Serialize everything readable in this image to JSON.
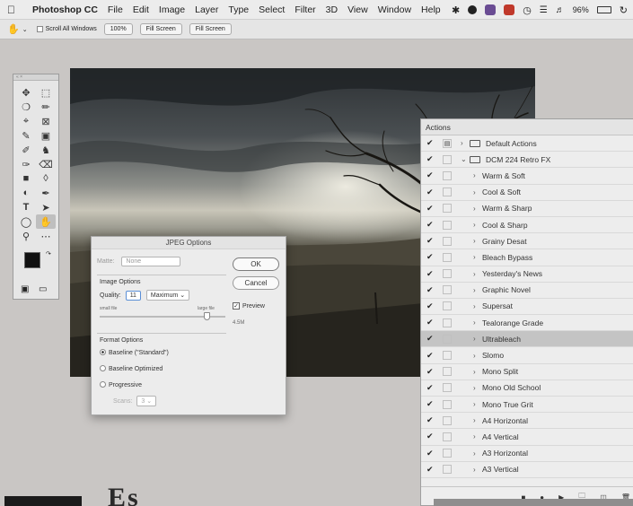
{
  "menubar": {
    "app_name": "Photoshop CC",
    "menus": [
      "File",
      "Edit",
      "Image",
      "Layer",
      "Type",
      "Select",
      "Filter",
      "3D",
      "View",
      "Window",
      "Help"
    ],
    "battery": "96%"
  },
  "options_bar": {
    "scroll_all_label": "Scroll All Windows",
    "zoom_100_label": "100%",
    "fit_screen_label": "Fill Screen",
    "fill_screen_label": "Fill Screen"
  },
  "jpeg_dialog": {
    "title": "JPEG Options",
    "matte_label": "Matte:",
    "matte_value": "None",
    "image_options_label": "Image Options",
    "quality_label": "Quality:",
    "quality_value": "11",
    "quality_preset": "Maximum",
    "small_file_label": "small file",
    "large_file_label": "large file",
    "quality_fraction": 0.85,
    "ok_label": "OK",
    "cancel_label": "Cancel",
    "preview_label": "Preview",
    "file_size": "4.5M",
    "format_options_label": "Format Options",
    "format_options": [
      "Baseline (\"Standard\")",
      "Baseline Optimized",
      "Progressive"
    ],
    "scans_label": "Scans:",
    "scans_value": "3"
  },
  "actions_panel": {
    "title": "Actions",
    "sets": [
      {
        "label": "Default Actions",
        "level": 1,
        "folder": true
      },
      {
        "label": "DCM 224 Retro FX",
        "level": 1,
        "folder": true,
        "expanded": true
      }
    ],
    "items": [
      "Warm & Soft",
      "Cool & Soft",
      "Warm & Sharp",
      "Cool & Sharp",
      "Grainy Desat",
      "Bleach Bypass",
      "Yesterday's News",
      "Graphic Novel",
      "Supersat",
      "Tealorange Grade",
      "Ultrableach",
      "Slomo",
      "Mono Split",
      "Mono Old School",
      "Mono True Grit",
      "A4 Horizontal",
      "A4 Vertical",
      "A3 Horizontal",
      "A3 Vertical"
    ],
    "highlighted": "Ultrableach"
  },
  "bottom_text": "Es"
}
